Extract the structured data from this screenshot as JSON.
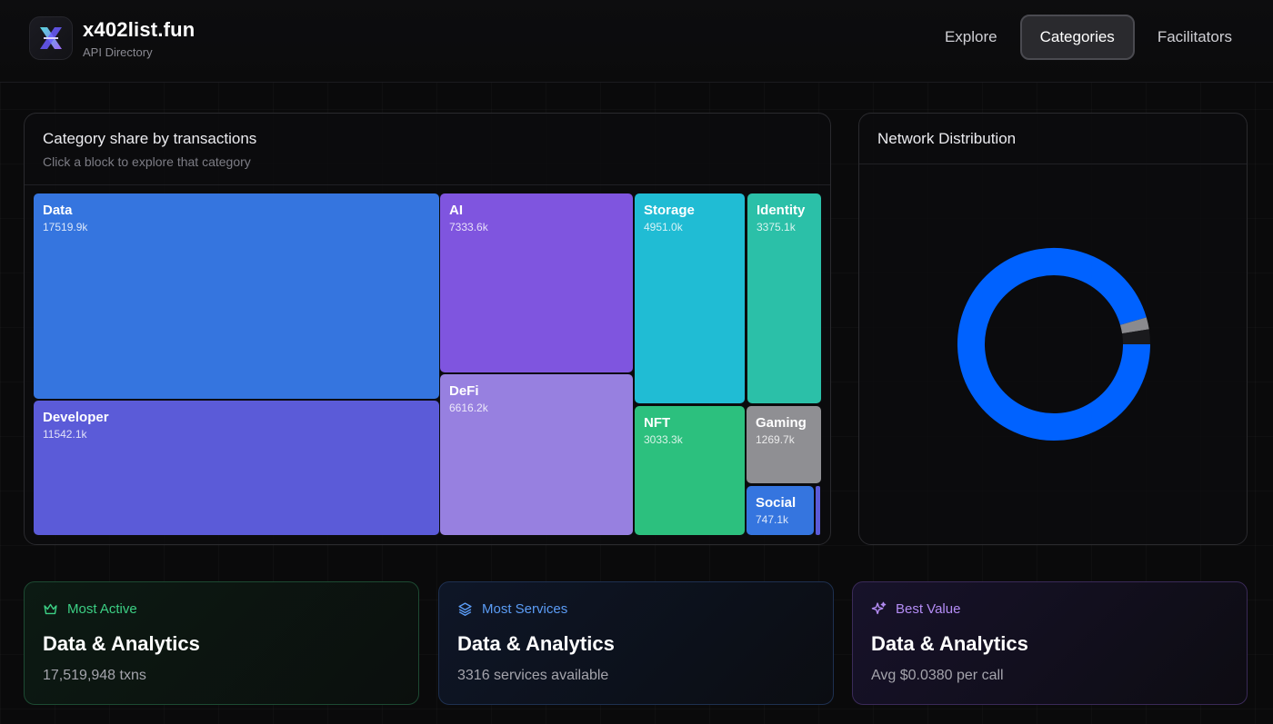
{
  "brand": {
    "title": "x402list.fun",
    "subtitle": "API Directory"
  },
  "nav": {
    "items": [
      {
        "label": "Explore",
        "active": false
      },
      {
        "label": "Categories",
        "active": true
      },
      {
        "label": "Facilitators",
        "active": false
      }
    ]
  },
  "treemap": {
    "title": "Category share by transactions",
    "subtitle": "Click a block to explore that category",
    "blocks": [
      {
        "name": "Data",
        "value": "17519.9k",
        "color": "#3575df"
      },
      {
        "name": "Developer",
        "value": "11542.1k",
        "color": "#5b5bd8"
      },
      {
        "name": "AI",
        "value": "7333.6k",
        "color": "#7f55df"
      },
      {
        "name": "DeFi",
        "value": "6616.2k",
        "color": "#9780e0"
      },
      {
        "name": "Storage",
        "value": "4951.0k",
        "color": "#20bcd4"
      },
      {
        "name": "Identity",
        "value": "3375.1k",
        "color": "#2bc0a8"
      },
      {
        "name": "NFT",
        "value": "3033.3k",
        "color": "#2cc07e"
      },
      {
        "name": "Gaming",
        "value": "1269.7k",
        "color": "#8f8f93"
      },
      {
        "name": "Social",
        "value": "747.1k",
        "color": "#3575df"
      },
      {
        "name": "",
        "value": "",
        "color": "#5b5bd8"
      }
    ]
  },
  "network": {
    "title": "Network Distribution",
    "donut": {
      "segments": [
        {
          "share": 0.955,
          "color": "#0062ff"
        },
        {
          "share": 0.02,
          "color": "#8a8a8e"
        },
        {
          "share": 0.025,
          "color": "#1a1a1d"
        }
      ]
    }
  },
  "stats": {
    "most_active": {
      "label": "Most Active",
      "value": "Data & Analytics",
      "detail": "17,519,948 txns",
      "color": "#3ccf84"
    },
    "most_services": {
      "label": "Most Services",
      "value": "Data & Analytics",
      "detail": "3316 services available",
      "color": "#5b9cf5"
    },
    "best_value": {
      "label": "Best Value",
      "value": "Data & Analytics",
      "detail": "Avg $0.0380 per call",
      "color": "#b48cf5"
    }
  }
}
